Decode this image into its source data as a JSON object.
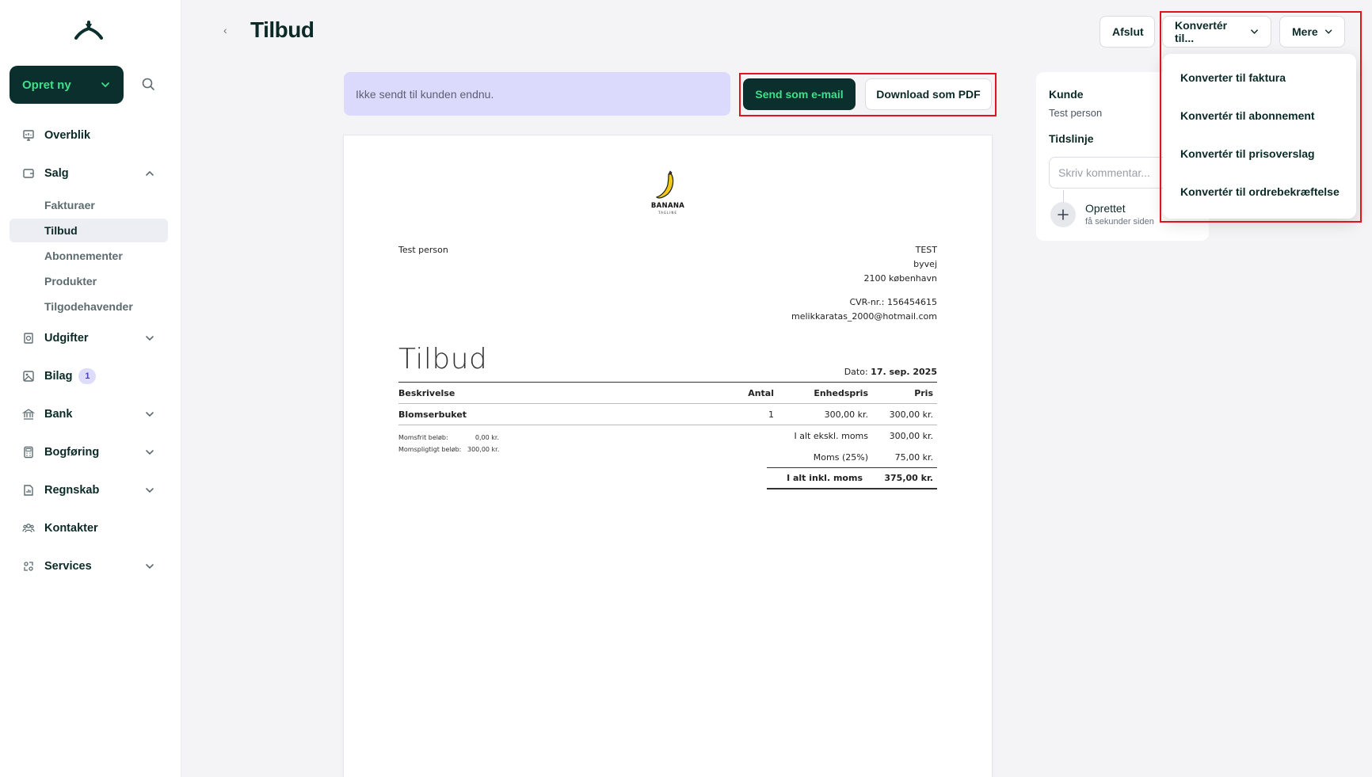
{
  "sidebar": {
    "create_label": "Opret ny",
    "items": {
      "overblik": "Overblik",
      "salg": "Salg",
      "fakturaer": "Fakturaer",
      "tilbud": "Tilbud",
      "abonnementer": "Abonnementer",
      "produkter": "Produkter",
      "tilgodehavender": "Tilgodehavender",
      "udgifter": "Udgifter",
      "bilag": "Bilag",
      "bilag_badge": "1",
      "bank": "Bank",
      "bogforing": "Bogføring",
      "regnskab": "Regnskab",
      "kontakter": "Kontakter",
      "services": "Services"
    }
  },
  "header": {
    "back": "‹",
    "title": "Tilbud",
    "afslut": "Afslut",
    "konverter": "Konvertér til...",
    "mere": "Mere"
  },
  "status": {
    "text": "Ikke sendt til kunden endnu.",
    "send_email": "Send som e-mail",
    "download_pdf": "Download som PDF"
  },
  "document": {
    "logo_text": "BANANA",
    "logo_sub": "TAGLINE",
    "customer_name": "Test person",
    "company": "TEST",
    "street": "byvej",
    "city": "2100 københavn",
    "cvr": "CVR-nr.: 156454615",
    "email": "melikkaratas_2000@hotmail.com",
    "title": "Tilbud",
    "date_label": "Dato:",
    "date_value": "17. sep. 2025",
    "columns": {
      "desc": "Beskrivelse",
      "qty": "Antal",
      "unit": "Enhedspris",
      "price": "Pris"
    },
    "line": {
      "desc": "Blomserbuket",
      "qty": "1",
      "unit": "300,00 kr.",
      "price": "300,00 kr."
    },
    "vat_free_label": "Momsfrit beløb:",
    "vat_free_value": "0,00 kr.",
    "vat_liable_label": "Momspligtigt beløb:",
    "vat_liable_value": "300,00 kr.",
    "subtotal_label": "I alt ekskl. moms",
    "subtotal_value": "300,00 kr.",
    "vat_label": "Moms (25%)",
    "vat_value": "75,00 kr.",
    "total_label": "I alt inkl. moms",
    "total_value": "375,00 kr."
  },
  "panel": {
    "kunde_label": "Kunde",
    "kunde_value": "Test person",
    "tidslinje_label": "Tidslinje",
    "comment_placeholder": "Skriv kommentar...",
    "event_title": "Oprettet",
    "event_time": "få sekunder siden"
  },
  "dropdown": {
    "items": [
      "Konverter til faktura",
      "Konvertér til abonnement",
      "Konvertér til prisoverslag",
      "Konvertér til ordrebekræftelse"
    ]
  },
  "colors": {
    "brand_dark": "#0b2f2c",
    "brand_green": "#3ee08b",
    "status_bg": "#dcdafc",
    "highlight_red": "#e1141e"
  }
}
